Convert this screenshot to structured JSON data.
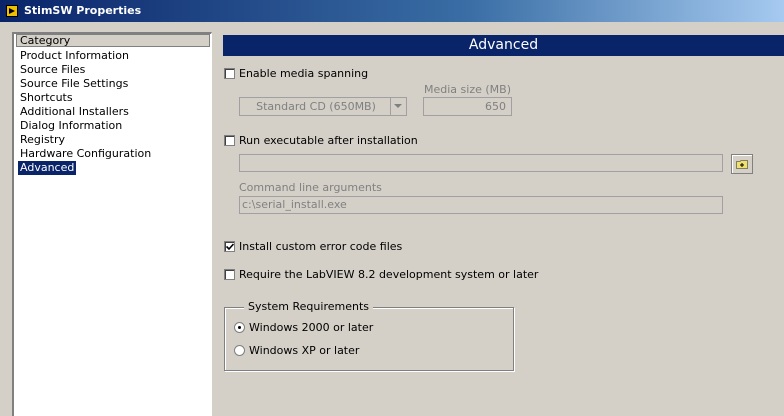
{
  "window": {
    "title": "StimSW Properties"
  },
  "category": {
    "header": "Category",
    "items": [
      {
        "label": "Product Information",
        "selected": false
      },
      {
        "label": "Source Files",
        "selected": false
      },
      {
        "label": "Source File Settings",
        "selected": false
      },
      {
        "label": "Shortcuts",
        "selected": false
      },
      {
        "label": "Additional Installers",
        "selected": false
      },
      {
        "label": "Dialog Information",
        "selected": false
      },
      {
        "label": "Registry",
        "selected": false
      },
      {
        "label": "Hardware Configuration",
        "selected": false
      },
      {
        "label": "Advanced",
        "selected": true
      }
    ]
  },
  "panel": {
    "title": "Advanced",
    "media_spanning": {
      "label": "Enable media spanning",
      "checked": false
    },
    "media_type": {
      "value": "Standard CD (650MB)"
    },
    "media_size": {
      "label": "Media size (MB)",
      "value": "650"
    },
    "run_executable": {
      "label": "Run executable after installation",
      "checked": false
    },
    "executable_path": {
      "value": ""
    },
    "command_line": {
      "label": "Command line arguments",
      "value": "c:\\serial_install.exe"
    },
    "custom_error": {
      "label": "Install custom error code files",
      "checked": true
    },
    "require_labview": {
      "label": "Require the LabVIEW 8.2 development system or later",
      "checked": false
    },
    "system_requirements": {
      "title": "System Requirements",
      "options": [
        {
          "label": "Windows 2000 or later",
          "selected": true
        },
        {
          "label": "Windows XP or later",
          "selected": false
        }
      ]
    }
  }
}
